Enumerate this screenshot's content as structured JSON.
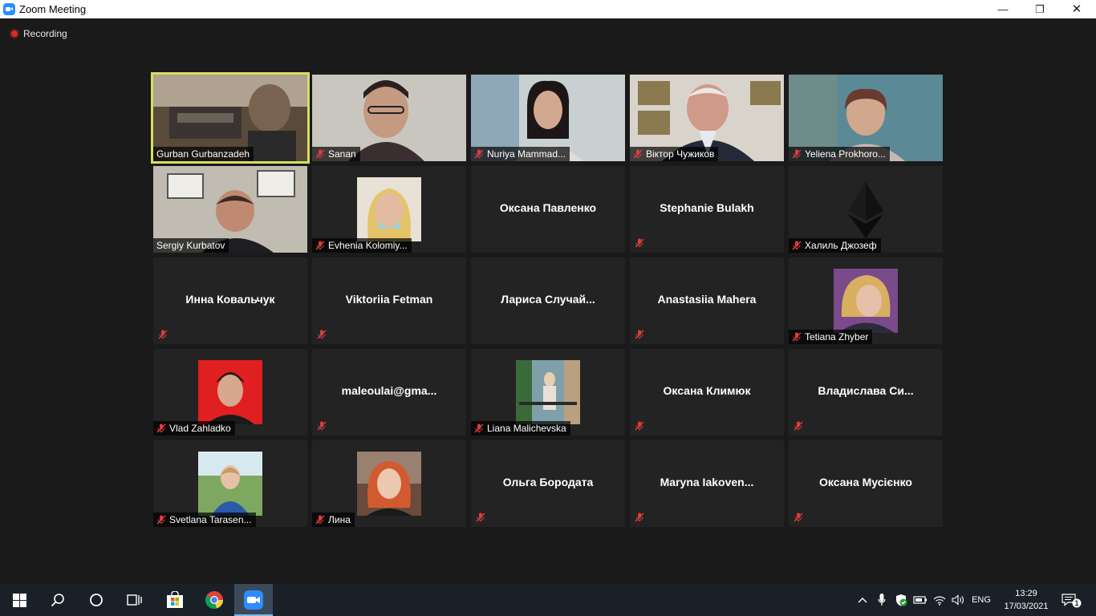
{
  "window": {
    "title": "Zoom Meeting",
    "minimize": "—",
    "restore": "❐",
    "close": "✕"
  },
  "recording": {
    "label": "Recording"
  },
  "participants": [
    {
      "name": "Gurban Gurbanzadeh",
      "video": true,
      "muted": false,
      "active": true
    },
    {
      "name": "Sanan",
      "video": true,
      "muted": true
    },
    {
      "name": "Nuriya Mammad...",
      "video": true,
      "muted": true
    },
    {
      "name": "Віктор Чужиков",
      "video": true,
      "muted": true
    },
    {
      "name": "Yeliena Prokhoro...",
      "video": true,
      "muted": true
    },
    {
      "name": "Sergiy Kurbatov",
      "video": true,
      "muted": false
    },
    {
      "name": "Evhenia Kolomiy...",
      "avatar": true,
      "muted": true
    },
    {
      "name": "Оксана Павленко",
      "video": false,
      "muted": false
    },
    {
      "name": "Stephanie Bulakh",
      "video": false,
      "muted": true
    },
    {
      "name": "Халиль Джозеф",
      "avatar": true,
      "muted": true
    },
    {
      "name": "Инна Ковальчук",
      "video": false,
      "muted": true
    },
    {
      "name": "Viktoriia Fetman",
      "video": false,
      "muted": true
    },
    {
      "name": "Лариса  Случай...",
      "video": false,
      "muted": false
    },
    {
      "name": "Anastasiia Mahera",
      "video": false,
      "muted": true
    },
    {
      "name": "Tetiana Zhyber",
      "avatar": true,
      "muted": true
    },
    {
      "name": "Vlad Zahladko",
      "avatar": true,
      "muted": true
    },
    {
      "name": "maleoulai@gma...",
      "video": false,
      "muted": true
    },
    {
      "name": "Liana Malichevska",
      "avatar": true,
      "muted": true
    },
    {
      "name": "Оксана Климюк",
      "video": false,
      "muted": true
    },
    {
      "name": "Владислава  Си...",
      "video": false,
      "muted": true
    },
    {
      "name": "Svetlana Tarasen...",
      "avatar": true,
      "muted": true
    },
    {
      "name": "Лина",
      "avatar": true,
      "muted": true
    },
    {
      "name": "Ольга Бородата",
      "video": false,
      "muted": true
    },
    {
      "name": "Maryna  Iakoven...",
      "video": false,
      "muted": true
    },
    {
      "name": "Оксана Мусієнко",
      "video": false,
      "muted": true
    }
  ],
  "taskbar": {
    "language": "ENG",
    "time": "13:29",
    "date": "17/03/2021",
    "notifications": "1"
  },
  "colors": {
    "active_border": "#d4df62",
    "muted_icon": "#e03c3c",
    "zoom_blue": "#2D8CFF"
  }
}
